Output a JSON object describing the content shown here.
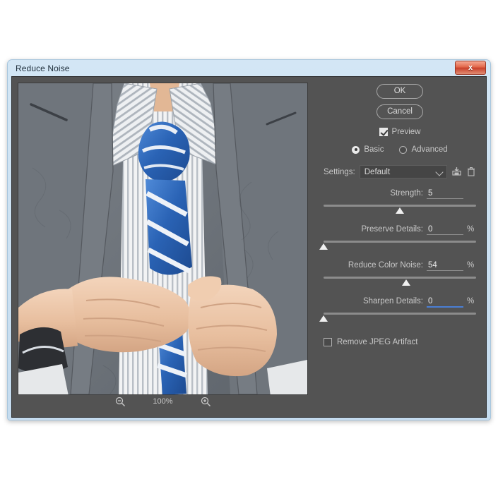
{
  "window": {
    "title": "Reduce Noise",
    "close_label": "x",
    "close_icon": "close-icon"
  },
  "preview": {
    "zoom_out_icon": "zoom-out-magnifier-icon",
    "zoom_in_icon": "zoom-in-magnifier-icon",
    "zoom_level": "100%",
    "image_description": "Man in gray suit adjusting a blue striped necktie over a white pinstriped shirt"
  },
  "controls": {
    "ok_label": "OK",
    "cancel_label": "Cancel",
    "preview_checkbox": {
      "label": "Preview",
      "checked": true
    },
    "mode": {
      "basic_label": "Basic",
      "advanced_label": "Advanced",
      "selected": "Basic"
    },
    "settings": {
      "label": "Settings:",
      "value": "Default",
      "save_icon": "save-preset-icon",
      "delete_icon": "trash-delete-preset-icon",
      "chevron_icon": "chevron-down-icon"
    },
    "sliders": [
      {
        "label": "Strength:",
        "value": "5",
        "unit": "",
        "percent": 50,
        "focused": false
      },
      {
        "label": "Preserve Details:",
        "value": "0",
        "unit": "%",
        "percent": 0,
        "focused": false
      },
      {
        "label": "Reduce Color Noise:",
        "value": "54",
        "unit": "%",
        "percent": 54,
        "focused": false
      },
      {
        "label": "Sharpen Details:",
        "value": "0",
        "unit": "%",
        "percent": 0,
        "focused": true
      }
    ],
    "jpeg_artifact": {
      "label": "Remove JPEG Artifact",
      "checked": false
    }
  },
  "colors": {
    "dialog_bg": "#535353",
    "titlebar_bg": "#cde2f2",
    "close_red": "#c9402a",
    "focus_blue": "#4a7fd4",
    "tie_blue": "#2a63b5"
  }
}
